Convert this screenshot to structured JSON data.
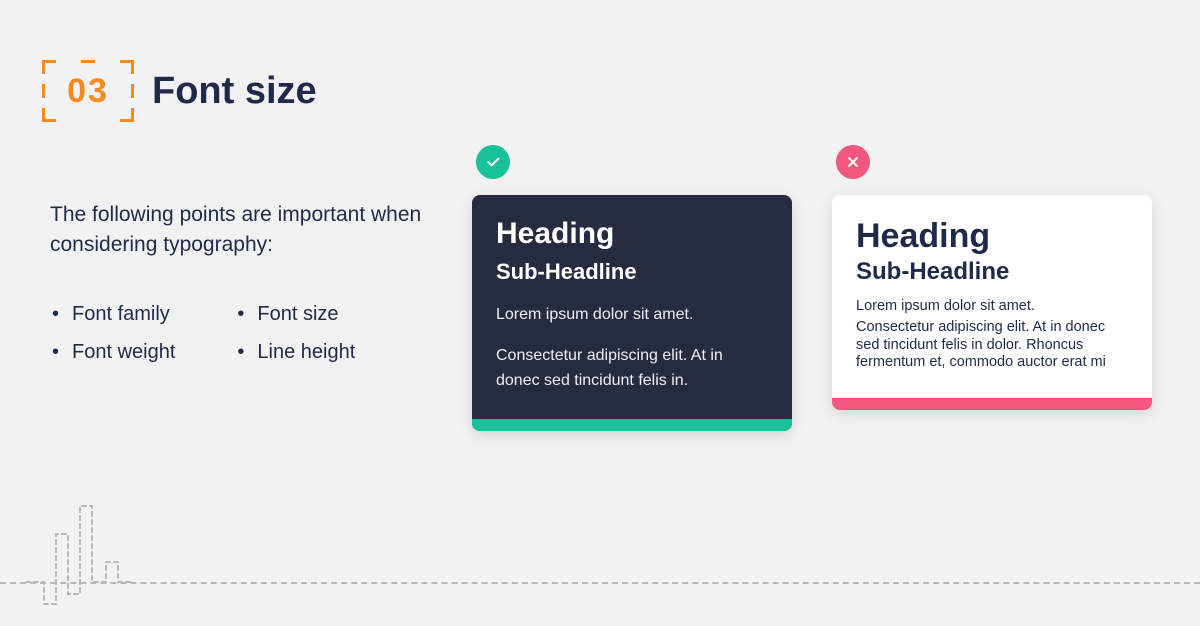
{
  "header": {
    "number": "03",
    "title": "Font size"
  },
  "intro": {
    "lead": "The following points are important when considering typography:",
    "bullets_col1": [
      "Font family",
      "Font weight"
    ],
    "bullets_col2": [
      "Font size",
      "Line height"
    ]
  },
  "examples": {
    "good": {
      "heading": "Heading",
      "sub": "Sub-Headline",
      "body1": "Lorem ipsum dolor sit amet.",
      "body2": "Consectetur adipiscing elit. At in donec sed tincidunt felis in."
    },
    "bad": {
      "heading": "Heading",
      "sub": "Sub-Headline",
      "body1": "Lorem ipsum dolor sit amet.",
      "body2": "Consectetur adipiscing elit. At in donec sed tincidunt felis in dolor. Rhoncus fermentum et, commodo auctor erat mi"
    }
  },
  "colors": {
    "accent_orange": "#f58a1f",
    "good": "#17c29b",
    "bad": "#f3577d",
    "card_dark": "#262c3f",
    "text": "#1e2a4a"
  }
}
